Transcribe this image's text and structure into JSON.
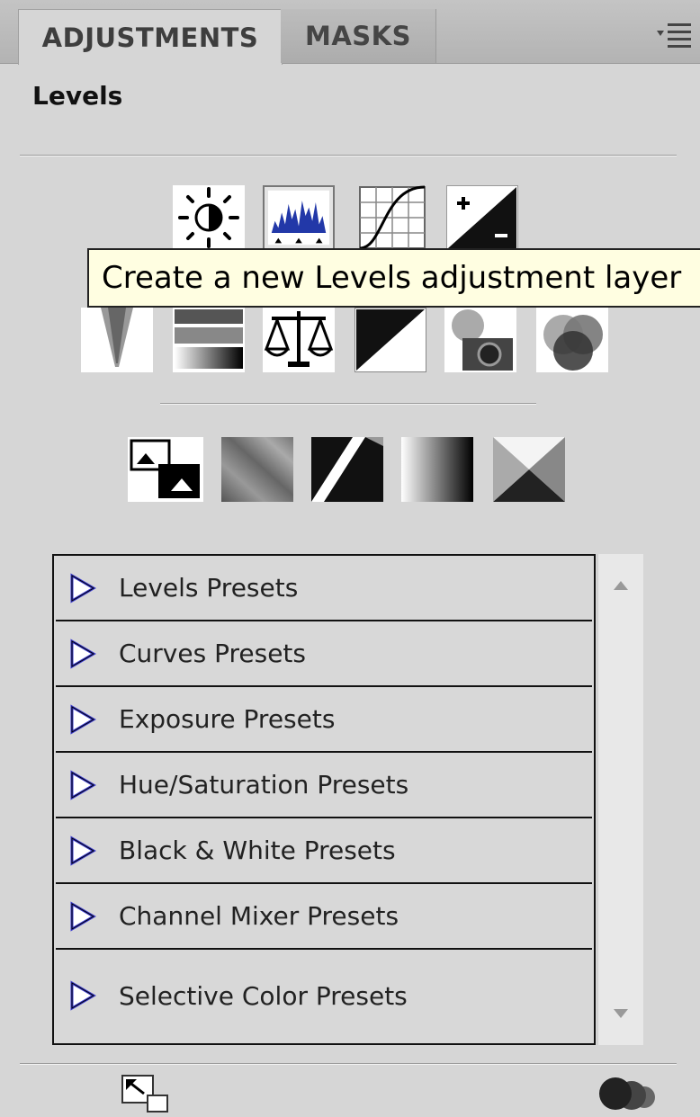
{
  "tabs": [
    {
      "label": "ADJUSTMENTS",
      "active": true
    },
    {
      "label": "MASKS",
      "active": false
    }
  ],
  "panel_menu_icon": "panel-menu-icon",
  "panel_title": "Levels",
  "tooltip": "Create a new Levels adjustment layer",
  "adjustment_icons": {
    "row1": [
      "brightness-contrast-icon",
      "levels-icon",
      "curves-icon",
      "exposure-icon"
    ],
    "row2": [
      "vibrance-icon",
      "hue-saturation-icon",
      "color-balance-icon",
      "black-white-icon",
      "photo-filter-icon",
      "channel-mixer-icon"
    ],
    "row3": [
      "invert-icon",
      "posterize-icon",
      "threshold-icon",
      "gradient-map-icon",
      "selective-color-icon"
    ]
  },
  "presets": [
    {
      "label": "Levels Presets"
    },
    {
      "label": "Curves Presets"
    },
    {
      "label": "Exposure Presets"
    },
    {
      "label": "Hue/Saturation Presets"
    },
    {
      "label": "Black & White Presets"
    },
    {
      "label": "Channel Mixer Presets"
    },
    {
      "label": "Selective Color Presets"
    }
  ],
  "footer_icons": [
    "expand-view-icon",
    "clip-to-layer-icon"
  ],
  "colors": {
    "preset_triangle": "#3a3ad0",
    "panel_bg": "#d6d6d6",
    "tooltip_bg": "#fffee1"
  }
}
